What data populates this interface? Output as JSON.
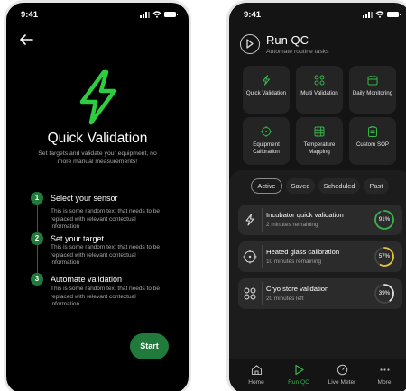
{
  "left_screen": {
    "status_time": "9:41",
    "title": "Quick Validation",
    "subtitle": "Set targets and validate your equipment, no more manual measurements!",
    "steps": [
      {
        "number": "1",
        "title": "Select your sensor",
        "body": "This is some random text that needs to be replaced with relevant contextual information"
      },
      {
        "number": "2",
        "title": "Set your target",
        "body": "This is some random text that needs to be replaced with relevant contextual information"
      },
      {
        "number": "3",
        "title": "Automate validation",
        "body": "This is some random text that needs to be replaced with relevant contextual information"
      }
    ],
    "start_label": "Start",
    "accent": "#1f7a3c",
    "bolt_color": "#2ecc40"
  },
  "right_screen": {
    "status_time": "9:41",
    "title": "Run QC",
    "subtitle": "Automate routine tasks",
    "tiles": [
      {
        "label": "Quick Validation",
        "icon": "bolt-icon"
      },
      {
        "label": "Multi Validation",
        "icon": "grid-circles-icon"
      },
      {
        "label": "Daily Monitoring",
        "icon": "calendar-icon"
      },
      {
        "label": "Equipment Calibration",
        "icon": "crosshair-icon"
      },
      {
        "label": "Temperature Mapping",
        "icon": "grid-icon"
      },
      {
        "label": "Custom SOP",
        "icon": "clipboard-icon"
      }
    ],
    "filters": [
      "Active",
      "Saved",
      "Scheduled",
      "Past"
    ],
    "active_filter": "Active",
    "tasks": [
      {
        "title": "Incubator quick validation",
        "sub": "2 minutes remaining",
        "progress": 91,
        "progress_label": "91%",
        "color": "#37b34a",
        "icon": "bolt-icon"
      },
      {
        "title": "Heated glass calibration",
        "sub": "10 minutes remaining",
        "progress": 57,
        "progress_label": "57%",
        "color": "#e2c23a",
        "icon": "crosshair-icon"
      },
      {
        "title": "Cryo store validation",
        "sub": "20 minutes left",
        "progress": 39,
        "progress_label": "39%",
        "color": "#e0e0e0",
        "icon": "grid-circles-icon"
      }
    ],
    "nav": [
      {
        "label": "Home",
        "icon": "home-icon"
      },
      {
        "label": "Run QC",
        "icon": "play-icon"
      },
      {
        "label": "Live Meter",
        "icon": "gauge-icon"
      },
      {
        "label": "More",
        "icon": "more-icon"
      }
    ],
    "selected_nav": "Run QC"
  }
}
